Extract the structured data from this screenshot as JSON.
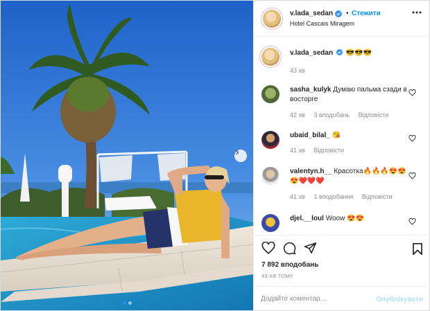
{
  "post": {
    "author": "v.lada_sedan",
    "follow_separator": "•",
    "follow_label": "Стежити",
    "location": "Hotel Cascais Miragem",
    "more_icon": "more-horizontal-icon"
  },
  "caption": {
    "username": "v.lada_sedan",
    "text": "😎😎😎",
    "time": "43 хв"
  },
  "comments": [
    {
      "username": "sasha_kulyk",
      "text": "Думаю пальма сзади в восторге",
      "time": "42 хв",
      "likes": "3 вподобань",
      "reply": "Відповісти"
    },
    {
      "username": "ubaid_bilal_",
      "text": "😘",
      "time": "41 хв",
      "likes": "",
      "reply": "Відповісти"
    },
    {
      "username": "valentyn.h__",
      "text": "Красотка🔥🔥🔥😍😍😍❤️❤️❤️",
      "time": "41 хв",
      "likes": "1 вподобання",
      "reply": "Відповісти"
    },
    {
      "username": "djel.__loul",
      "text": "Woow 😍😍",
      "time": "",
      "likes": "",
      "reply": ""
    }
  ],
  "actions": {
    "likes_count": "7 892 вподобань",
    "posted_time": "43 ХВ ТОМУ"
  },
  "comment_box": {
    "placeholder": "Додайте коментар...",
    "publish_label": "Опублікувати"
  },
  "carousel": {
    "dot_count": 2,
    "active_index": 0
  },
  "colors": {
    "link_blue": "#0095f6",
    "publish_disabled": "#b2dffc",
    "meta_gray": "#8e8e8e",
    "verified_blue": "#3897f0"
  }
}
